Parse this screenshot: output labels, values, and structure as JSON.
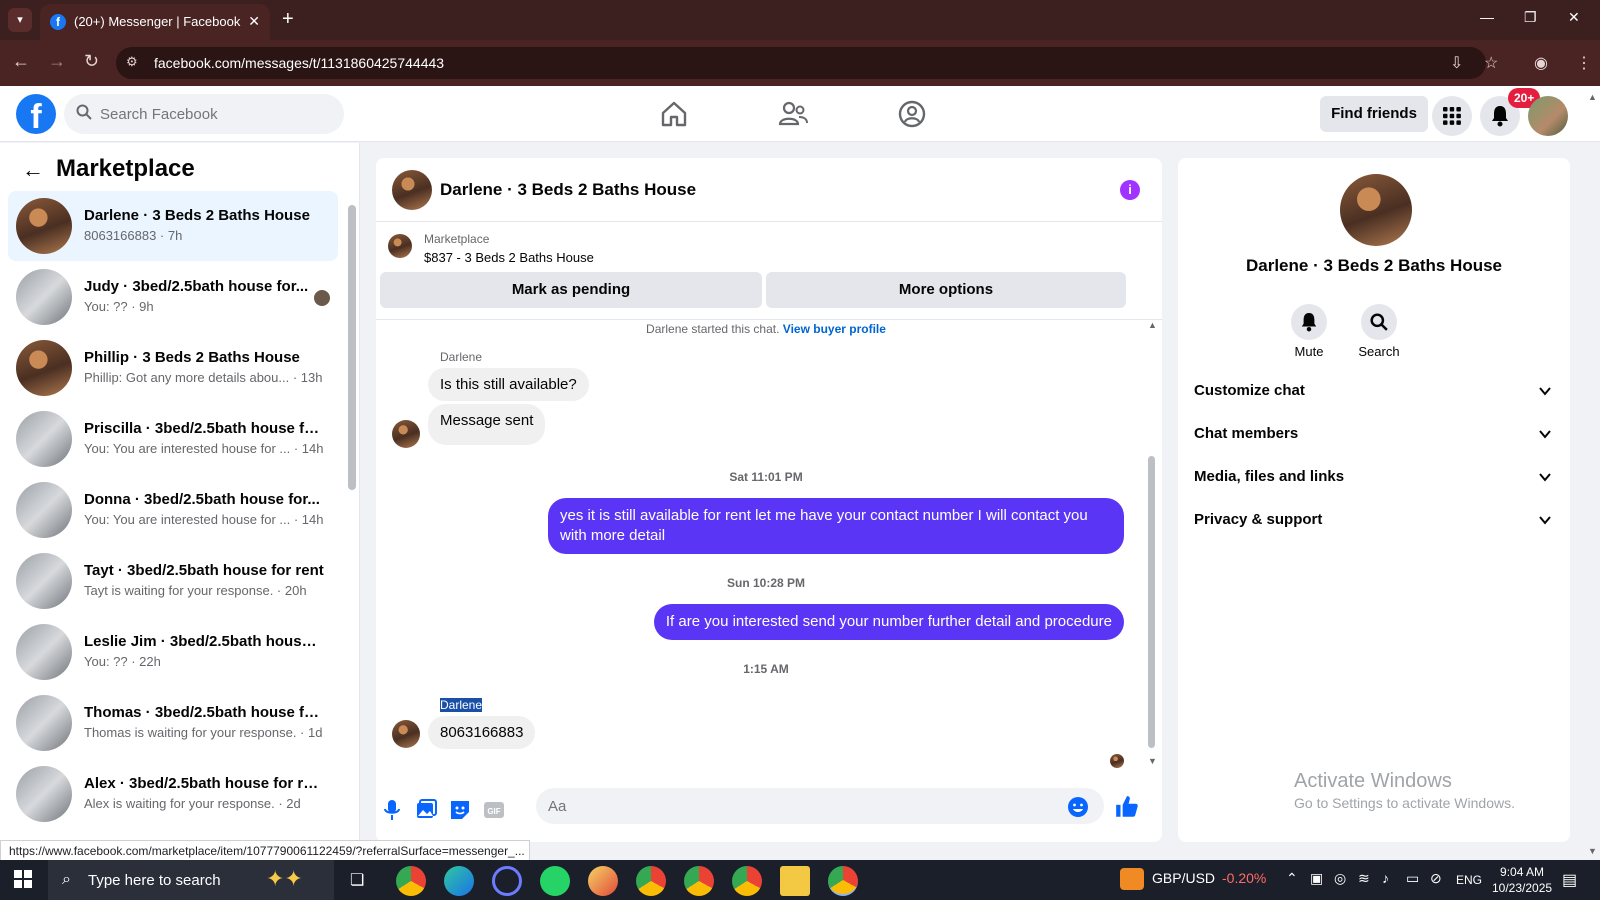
{
  "browser": {
    "tab_title": "(20+) Messenger | Facebook",
    "url": "facebook.com/messages/t/1131860425744443",
    "status_url": "https://www.facebook.com/marketplace/item/1077790061122459/?referralSurface=messenger_..."
  },
  "header": {
    "search_placeholder": "Search Facebook",
    "find_friends": "Find friends",
    "notif_badge": "20+"
  },
  "left": {
    "title": "Marketplace",
    "conversations": [
      {
        "name": "Darlene · 3 Beds 2 Baths House",
        "sub": "8063166883 · 7h"
      },
      {
        "name": "Judy · 3bed/2.5bath house for...",
        "sub": "You: ?? · 9h"
      },
      {
        "name": "Phillip · 3 Beds 2 Baths House",
        "sub": "Phillip: Got any more details abou... · 13h"
      },
      {
        "name": "Priscilla · 3bed/2.5bath house fo...",
        "sub": "You: You are interested house for ... · 14h"
      },
      {
        "name": "Donna · 3bed/2.5bath house for...",
        "sub": "You: You are interested house for ... · 14h"
      },
      {
        "name": "Tayt · 3bed/2.5bath house for rent",
        "sub": "Tayt is waiting for your response. · 20h"
      },
      {
        "name": "Leslie Jim · 3bed/2.5bath house ...",
        "sub": "You: ?? · 22h"
      },
      {
        "name": "Thomas · 3bed/2.5bath house fo...",
        "sub": "Thomas is waiting for your response. · 1d"
      },
      {
        "name": "Alex · 3bed/2.5bath house for re...",
        "sub": "Alex is waiting for your response. · 2d"
      }
    ]
  },
  "chat": {
    "title": "Darlene · 3 Beds 2 Baths House",
    "marketplace_label": "Marketplace",
    "item": "$837 - 3 Beds 2 Baths House",
    "mark_pending": "Mark as pending",
    "more_options": "More options",
    "started_text": "Darlene started this chat.",
    "view_buyer": "View buyer profile",
    "sender_1": "Darlene",
    "in_1": "Is this still available?",
    "in_2": "Message sent",
    "ts_1": "Sat 11:01 PM",
    "out_1": "yes it is still available for rent let me have your contact number I will contact you with more detail",
    "ts_2": "Sun 10:28 PM",
    "out_2": "If are you interested send your number further detail and procedure",
    "ts_3": "1:15 AM",
    "sender_2": "Darlene",
    "in_3": "8063166883",
    "composer_placeholder": "Aa"
  },
  "info": {
    "name": "Darlene · 3 Beds 2 Baths House",
    "mute": "Mute",
    "search": "Search",
    "sections": [
      "Customize chat",
      "Chat members",
      "Media, files and links",
      "Privacy & support"
    ],
    "watermark_1": "Activate Windows",
    "watermark_2": "Go to Settings to activate Windows."
  },
  "taskbar": {
    "search_text": "Type here to search",
    "ticker_pair": "GBP/USD",
    "ticker_change": "-0.20%",
    "lang": "ENG",
    "time": "9:04 AM",
    "date": "10/23/2025"
  },
  "colors": {
    "fb_blue": "#1877f2",
    "outgoing_bubble": "#5b35f5",
    "chrome_frame": "#3c1f1f",
    "badge_red": "#e41e3f",
    "ticker_red": "#ff6b6b"
  }
}
